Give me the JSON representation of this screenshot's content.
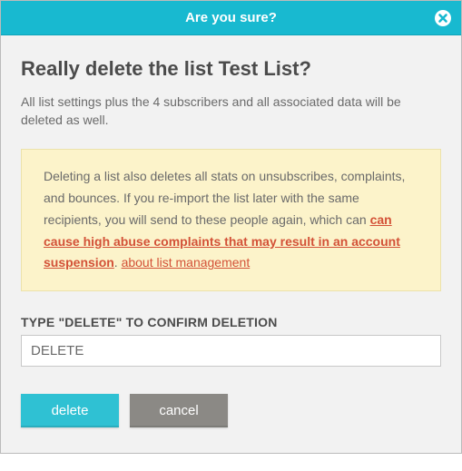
{
  "header": {
    "title": "Are you sure?"
  },
  "main": {
    "heading": "Really delete the list Test List?",
    "description": "All list settings plus the 4 subscribers and all associated data will be deleted as well.",
    "warning": {
      "text_before": "Deleting a list also deletes all stats on unsubscribes, complaints, and bounces. If you re-import the list later with the same recipients, you will send to these people again, which can ",
      "link_strong": "can cause high abuse complaints that may result in an account suspension",
      "separator": ". ",
      "link_plain": "about list management"
    },
    "confirm_label": "TYPE \"DELETE\" TO CONFIRM DELETION",
    "confirm_value": "DELETE"
  },
  "buttons": {
    "delete": "delete",
    "cancel": "cancel"
  },
  "colors": {
    "accent": "#18b9d0",
    "warning_bg": "#fcf3ca",
    "danger_link": "#d35137"
  }
}
